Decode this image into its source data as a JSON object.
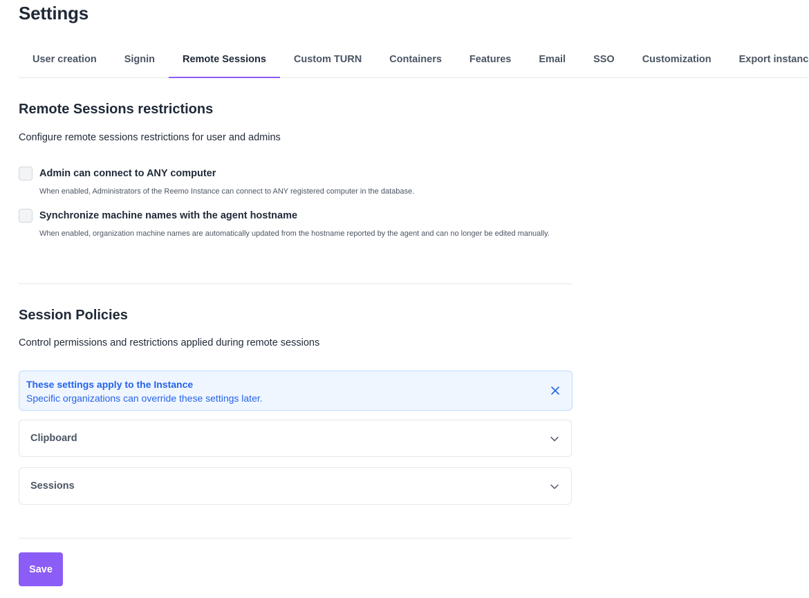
{
  "page": {
    "title": "Settings"
  },
  "tabs": [
    {
      "label": "User creation"
    },
    {
      "label": "Signin"
    },
    {
      "label": "Remote Sessions",
      "active": true
    },
    {
      "label": "Custom TURN"
    },
    {
      "label": "Containers"
    },
    {
      "label": "Features"
    },
    {
      "label": "Email"
    },
    {
      "label": "SSO"
    },
    {
      "label": "Customization"
    },
    {
      "label": "Export instance"
    }
  ],
  "restrictions": {
    "title": "Remote Sessions restrictions",
    "description": "Configure remote sessions restrictions for user and admins",
    "options": [
      {
        "label": "Admin can connect to ANY computer",
        "help": "When enabled, Administrators of the Reemo Instance can connect to ANY registered computer in the database.",
        "checked": false
      },
      {
        "label": "Synchronize machine names with the agent hostname",
        "help": "When enabled, organization machine names are automatically updated from the hostname reported by the agent and can no longer be edited manually.",
        "checked": false
      }
    ]
  },
  "policies": {
    "title": "Session Policies",
    "description": "Control permissions and restrictions applied during remote sessions",
    "alert": {
      "title": "These settings apply to the Instance",
      "text": "Specific organizations can override these settings later.",
      "close_icon": "close-icon"
    },
    "accordions": [
      {
        "label": "Clipboard",
        "icon": "chevron-down-icon"
      },
      {
        "label": "Sessions",
        "icon": "chevron-down-icon"
      }
    ]
  },
  "actions": {
    "save_label": "Save"
  },
  "colors": {
    "accent": "#8b5cf6",
    "info_text": "#2563eb",
    "info_bg": "#eff6ff",
    "info_border": "#bfdbfe"
  }
}
